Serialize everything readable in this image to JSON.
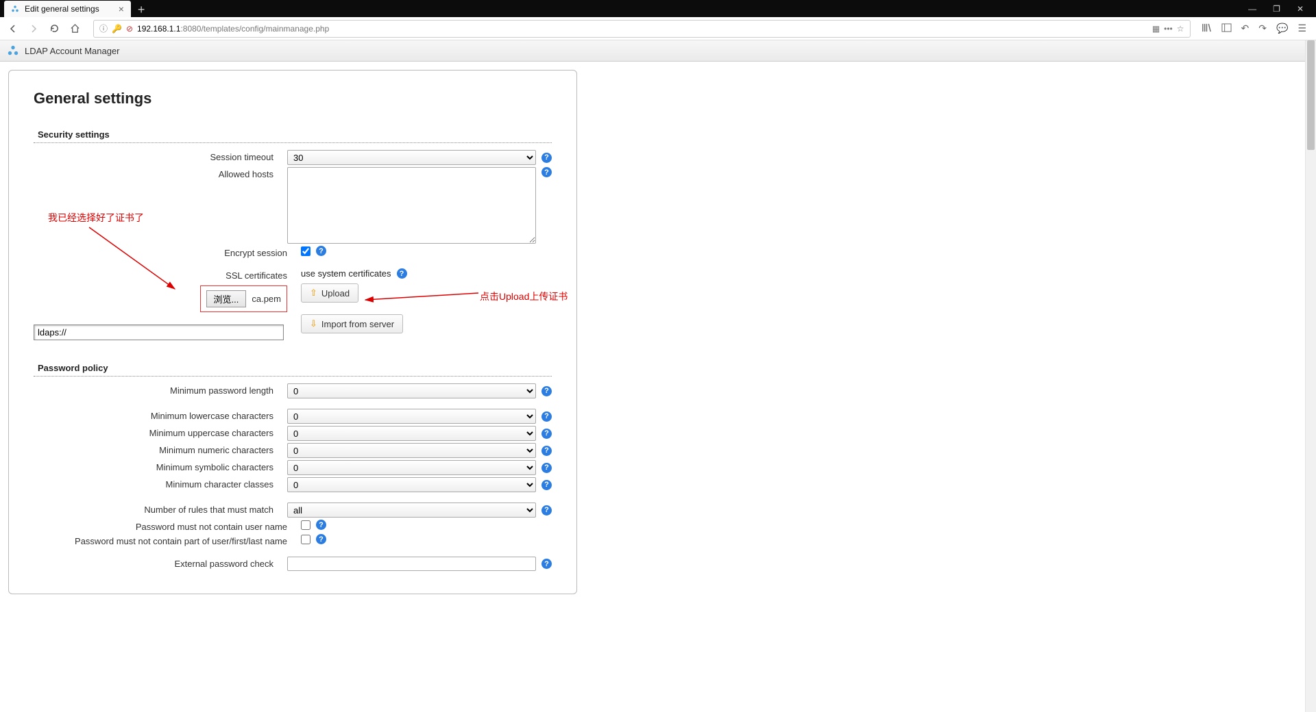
{
  "browser": {
    "tab_title": "Edit general settings",
    "url_host": "192.168.1.1",
    "url_port_path": ":8080/templates/config/mainmanage.php"
  },
  "app": {
    "title": "LDAP Account Manager"
  },
  "page": {
    "title": "General settings"
  },
  "security": {
    "legend": "Security settings",
    "session_timeout_label": "Session timeout",
    "session_timeout_value": "30",
    "allowed_hosts_label": "Allowed hosts",
    "allowed_hosts_value": "",
    "encrypt_session_label": "Encrypt session",
    "encrypt_session_checked": true,
    "ssl_certificates_label": "SSL certificates",
    "ssl_use_system_text": "use system certificates",
    "browse_button": "浏览...",
    "selected_file": "ca.pem",
    "upload_button": "Upload",
    "import_button": "Import from server",
    "ldaps_value": "ldaps://"
  },
  "password": {
    "legend": "Password policy",
    "min_length_label": "Minimum password length",
    "min_length_value": "0",
    "min_lower_label": "Minimum lowercase characters",
    "min_lower_value": "0",
    "min_upper_label": "Minimum uppercase characters",
    "min_upper_value": "0",
    "min_numeric_label": "Minimum numeric characters",
    "min_numeric_value": "0",
    "min_symbol_label": "Minimum symbolic characters",
    "min_symbol_value": "0",
    "min_classes_label": "Minimum character classes",
    "min_classes_value": "0",
    "rules_match_label": "Number of rules that must match",
    "rules_match_value": "all",
    "no_username_label": "Password must not contain user name",
    "no_username_checked": false,
    "no_userpart_label": "Password must not contain part of user/first/last name",
    "no_userpart_checked": false,
    "external_check_label": "External password check",
    "external_check_value": ""
  },
  "annotations": {
    "left_note": "我已经选择好了证书了",
    "right_note": "点击Upload上传证书"
  }
}
